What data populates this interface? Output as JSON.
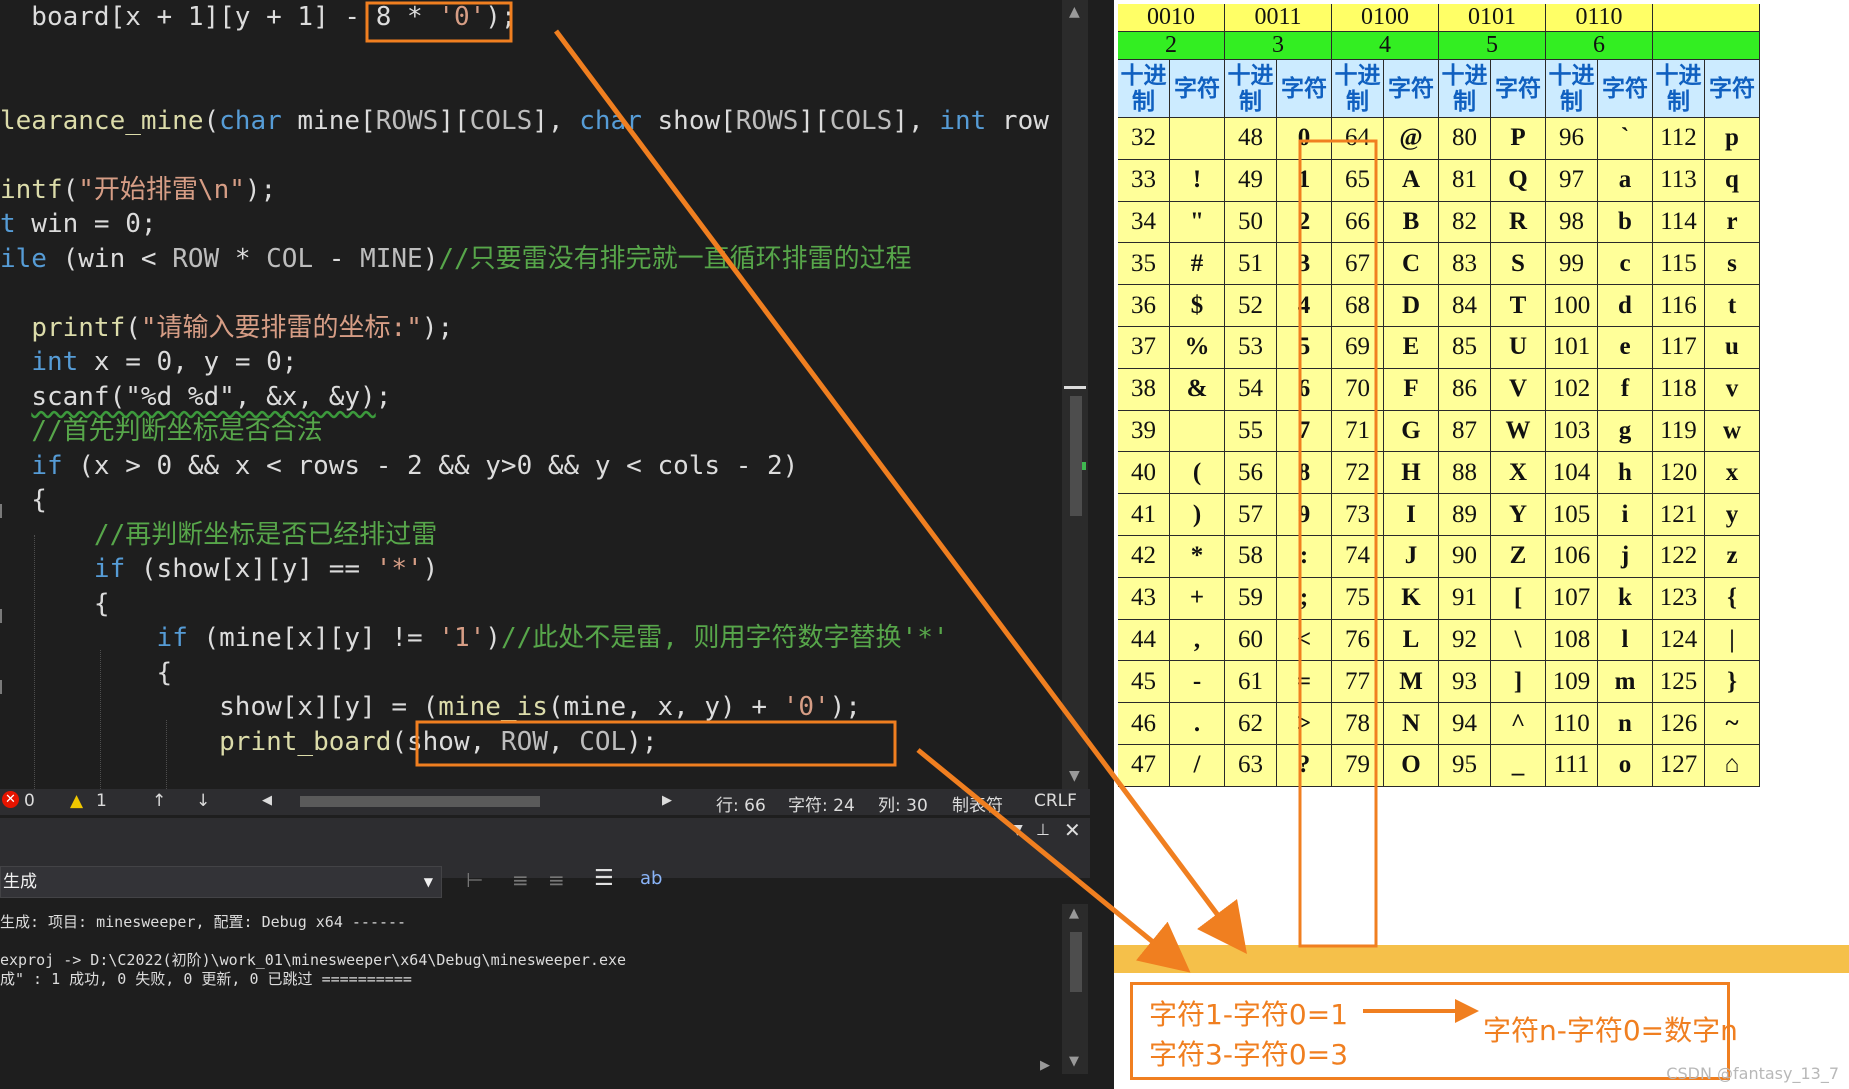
{
  "code_lines": [
    {
      "line": 1,
      "tokens": [
        {
          "t": "  board[x + 1][y + 1] - ",
          "c": "plain"
        },
        {
          "t": "8",
          "c": "plain"
        },
        {
          "t": " * ",
          "c": "plain"
        },
        {
          "t": "'0'",
          "c": "str"
        },
        {
          "t": ");",
          "c": "plain"
        }
      ]
    },
    {
      "line": 2,
      "tokens": []
    },
    {
      "line": 3,
      "tokens": []
    },
    {
      "line": 4,
      "tokens": [
        {
          "t": "learance_mine",
          "c": "fn"
        },
        {
          "t": "(",
          "c": "plain"
        },
        {
          "t": "char",
          "c": "kw"
        },
        {
          "t": " mine[",
          "c": "plain"
        },
        {
          "t": "ROWS",
          "c": "mac"
        },
        {
          "t": "][",
          "c": "plain"
        },
        {
          "t": "COLS",
          "c": "mac"
        },
        {
          "t": "], ",
          "c": "plain"
        },
        {
          "t": "char",
          "c": "kw"
        },
        {
          "t": " show[",
          "c": "plain"
        },
        {
          "t": "ROWS",
          "c": "mac"
        },
        {
          "t": "][",
          "c": "plain"
        },
        {
          "t": "COLS",
          "c": "mac"
        },
        {
          "t": "], ",
          "c": "plain"
        },
        {
          "t": "int",
          "c": "kw"
        },
        {
          "t": " row",
          "c": "plain"
        }
      ]
    },
    {
      "line": 5,
      "tokens": []
    },
    {
      "line": 6,
      "tokens": [
        {
          "t": "intf",
          "c": "fn"
        },
        {
          "t": "(",
          "c": "plain"
        },
        {
          "t": "\"开始排雷\\n\"",
          "c": "str"
        },
        {
          "t": ");",
          "c": "plain"
        }
      ]
    },
    {
      "line": 7,
      "tokens": [
        {
          "t": "t",
          "c": "kw"
        },
        {
          "t": " win = 0;",
          "c": "plain"
        }
      ]
    },
    {
      "line": 8,
      "tokens": [
        {
          "t": "ile",
          "c": "kw"
        },
        {
          "t": " (win < ",
          "c": "plain"
        },
        {
          "t": "ROW",
          "c": "mac"
        },
        {
          "t": " * ",
          "c": "plain"
        },
        {
          "t": "COL",
          "c": "mac"
        },
        {
          "t": " - ",
          "c": "plain"
        },
        {
          "t": "MINE",
          "c": "mac"
        },
        {
          "t": ")",
          "c": "plain"
        },
        {
          "t": "//只要雷没有排完就一直循环排雷的过程",
          "c": "cm"
        }
      ]
    },
    {
      "line": 9,
      "tokens": []
    },
    {
      "line": 10,
      "tokens": [
        {
          "t": "  ",
          "c": "plain"
        },
        {
          "t": "printf",
          "c": "fn"
        },
        {
          "t": "(",
          "c": "plain"
        },
        {
          "t": "\"请输入要排雷的坐标:\"",
          "c": "str"
        },
        {
          "t": ");",
          "c": "plain"
        }
      ]
    },
    {
      "line": 11,
      "tokens": [
        {
          "t": "  ",
          "c": "plain"
        },
        {
          "t": "int",
          "c": "kw"
        },
        {
          "t": " x = 0, y = 0;",
          "c": "plain"
        }
      ]
    },
    {
      "line": 12,
      "tokens": [
        {
          "t": "  ",
          "c": "plain"
        },
        {
          "t": "scanf(\"%d %d\", &x, &y)",
          "c": "sq"
        },
        {
          "t": ";",
          "c": "plain"
        }
      ]
    },
    {
      "line": 13,
      "tokens": [
        {
          "t": "  ",
          "c": "plain"
        },
        {
          "t": "//首先判断坐标是否合法",
          "c": "cm"
        }
      ]
    },
    {
      "line": 14,
      "tokens": [
        {
          "t": "  ",
          "c": "plain"
        },
        {
          "t": "if",
          "c": "kw"
        },
        {
          "t": " (x > 0 && x < rows - 2 && y>0 && y < cols - 2)",
          "c": "plain"
        }
      ]
    },
    {
      "line": 15,
      "tokens": [
        {
          "t": "  {",
          "c": "plain"
        }
      ]
    },
    {
      "line": 16,
      "tokens": [
        {
          "t": "      ",
          "c": "plain"
        },
        {
          "t": "//再判断坐标是否已经排过雷",
          "c": "cm"
        }
      ]
    },
    {
      "line": 17,
      "tokens": [
        {
          "t": "      ",
          "c": "plain"
        },
        {
          "t": "if",
          "c": "kw"
        },
        {
          "t": " (show[x][y] == ",
          "c": "plain"
        },
        {
          "t": "'*'",
          "c": "str"
        },
        {
          "t": ")",
          "c": "plain"
        }
      ]
    },
    {
      "line": 18,
      "tokens": [
        {
          "t": "      {",
          "c": "plain"
        }
      ]
    },
    {
      "line": 19,
      "tokens": [
        {
          "t": "          ",
          "c": "plain"
        },
        {
          "t": "if",
          "c": "kw"
        },
        {
          "t": " (mine[x][y] != ",
          "c": "plain"
        },
        {
          "t": "'1'",
          "c": "str"
        },
        {
          "t": ")",
          "c": "plain"
        },
        {
          "t": "//此处不是雷, 则用字符数字替换'*'",
          "c": "cm"
        }
      ]
    },
    {
      "line": 20,
      "tokens": [
        {
          "t": "          {",
          "c": "plain"
        }
      ]
    },
    {
      "line": 21,
      "tokens": [
        {
          "t": "              show[x][y] = ",
          "c": "plain"
        },
        {
          "t": "(",
          "c": "plain"
        },
        {
          "t": "mine_is",
          "c": "fn"
        },
        {
          "t": "(mine, x, y) + ",
          "c": "plain"
        },
        {
          "t": "'0'",
          "c": "str"
        },
        {
          "t": ");",
          "c": "plain"
        }
      ]
    },
    {
      "line": 22,
      "tokens": [
        {
          "t": "              ",
          "c": "plain"
        },
        {
          "t": "print_board",
          "c": "fn"
        },
        {
          "t": "(show, ",
          "c": "plain"
        },
        {
          "t": "ROW",
          "c": "mac"
        },
        {
          "t": ", ",
          "c": "plain"
        },
        {
          "t": "COL",
          "c": "mac"
        },
        {
          "t": ");",
          "c": "plain"
        }
      ]
    }
  ],
  "status_bar": {
    "errors": "0",
    "warnings": "1",
    "row": "行: 66",
    "chars": "字符: 24",
    "col": "列: 30",
    "tabs": "制表符",
    "line_ending": "CRLF"
  },
  "output_panel": {
    "source": "生成",
    "lines": [
      "生成: 项目: minesweeper, 配置: Debug x64 ------",
      "",
      "exproj -> D:\\C2022(初阶)\\work_01\\minesweeper\\x64\\Debug\\minesweeper.exe",
      "成\" : 1 成功, 0 失败, 0 更新, 0 已跳过 =========="
    ]
  },
  "ascii_table": {
    "binary_headers": [
      "0010",
      "0011",
      "0100",
      "0101",
      "0110",
      ""
    ],
    "decimal_headers": [
      "2",
      "3",
      "4",
      "5",
      "6",
      ""
    ],
    "sub_headers": [
      "十进制",
      "字符"
    ],
    "rows": [
      [
        [
          "32",
          " "
        ],
        [
          "48",
          "0"
        ],
        [
          "64",
          "@"
        ],
        [
          "80",
          "P"
        ],
        [
          "96",
          "`"
        ],
        [
          "112",
          "p"
        ]
      ],
      [
        [
          "33",
          "!"
        ],
        [
          "49",
          "1"
        ],
        [
          "65",
          "A"
        ],
        [
          "81",
          "Q"
        ],
        [
          "97",
          "a"
        ],
        [
          "113",
          "q"
        ]
      ],
      [
        [
          "34",
          "\""
        ],
        [
          "50",
          "2"
        ],
        [
          "66",
          "B"
        ],
        [
          "82",
          "R"
        ],
        [
          "98",
          "b"
        ],
        [
          "114",
          "r"
        ]
      ],
      [
        [
          "35",
          "#"
        ],
        [
          "51",
          "3"
        ],
        [
          "67",
          "C"
        ],
        [
          "83",
          "S"
        ],
        [
          "99",
          "c"
        ],
        [
          "115",
          "s"
        ]
      ],
      [
        [
          "36",
          "$"
        ],
        [
          "52",
          "4"
        ],
        [
          "68",
          "D"
        ],
        [
          "84",
          "T"
        ],
        [
          "100",
          "d"
        ],
        [
          "116",
          "t"
        ]
      ],
      [
        [
          "37",
          "%"
        ],
        [
          "53",
          "5"
        ],
        [
          "69",
          "E"
        ],
        [
          "85",
          "U"
        ],
        [
          "101",
          "e"
        ],
        [
          "117",
          "u"
        ]
      ],
      [
        [
          "38",
          "&"
        ],
        [
          "54",
          "6"
        ],
        [
          "70",
          "F"
        ],
        [
          "86",
          "V"
        ],
        [
          "102",
          "f"
        ],
        [
          "118",
          "v"
        ]
      ],
      [
        [
          "39",
          ""
        ],
        [
          "55",
          "7"
        ],
        [
          "71",
          "G"
        ],
        [
          "87",
          "W"
        ],
        [
          "103",
          "g"
        ],
        [
          "119",
          "w"
        ]
      ],
      [
        [
          "40",
          "("
        ],
        [
          "56",
          "8"
        ],
        [
          "72",
          "H"
        ],
        [
          "88",
          "X"
        ],
        [
          "104",
          "h"
        ],
        [
          "120",
          "x"
        ]
      ],
      [
        [
          "41",
          ")"
        ],
        [
          "57",
          "9"
        ],
        [
          "73",
          "I"
        ],
        [
          "89",
          "Y"
        ],
        [
          "105",
          "i"
        ],
        [
          "121",
          "y"
        ]
      ],
      [
        [
          "42",
          "*"
        ],
        [
          "58",
          ":"
        ],
        [
          "74",
          "J"
        ],
        [
          "90",
          "Z"
        ],
        [
          "106",
          "j"
        ],
        [
          "122",
          "z"
        ]
      ],
      [
        [
          "43",
          "+"
        ],
        [
          "59",
          ";"
        ],
        [
          "75",
          "K"
        ],
        [
          "91",
          "["
        ],
        [
          "107",
          "k"
        ],
        [
          "123",
          "{"
        ]
      ],
      [
        [
          "44",
          ","
        ],
        [
          "60",
          "<"
        ],
        [
          "76",
          "L"
        ],
        [
          "92",
          "\\"
        ],
        [
          "108",
          "l"
        ],
        [
          "124",
          "|"
        ]
      ],
      [
        [
          "45",
          "-"
        ],
        [
          "61",
          "="
        ],
        [
          "77",
          "M"
        ],
        [
          "93",
          "]"
        ],
        [
          "109",
          "m"
        ],
        [
          "125",
          "}"
        ]
      ],
      [
        [
          "46",
          "."
        ],
        [
          "62",
          ">"
        ],
        [
          "78",
          "N"
        ],
        [
          "94",
          "^"
        ],
        [
          "110",
          "n"
        ],
        [
          "126",
          "~"
        ]
      ],
      [
        [
          "47",
          "/"
        ],
        [
          "63",
          "?"
        ],
        [
          "79",
          "O"
        ],
        [
          "95",
          "_"
        ],
        [
          "111",
          "o"
        ],
        [
          "127",
          "⌂"
        ]
      ]
    ]
  },
  "annotation": {
    "line1": "字符1-字符0=1",
    "line2": "字符3-字符0=3",
    "result": "字符n-字符0=数字n"
  },
  "watermark": "CSDN @fantasy_13_7",
  "colors": {
    "highlight": "#f07f20",
    "editor_bg": "#1e1e1e",
    "keyword": "#569cd6",
    "function": "#dcdcaa",
    "string": "#d69d85",
    "comment": "#57a64a"
  }
}
